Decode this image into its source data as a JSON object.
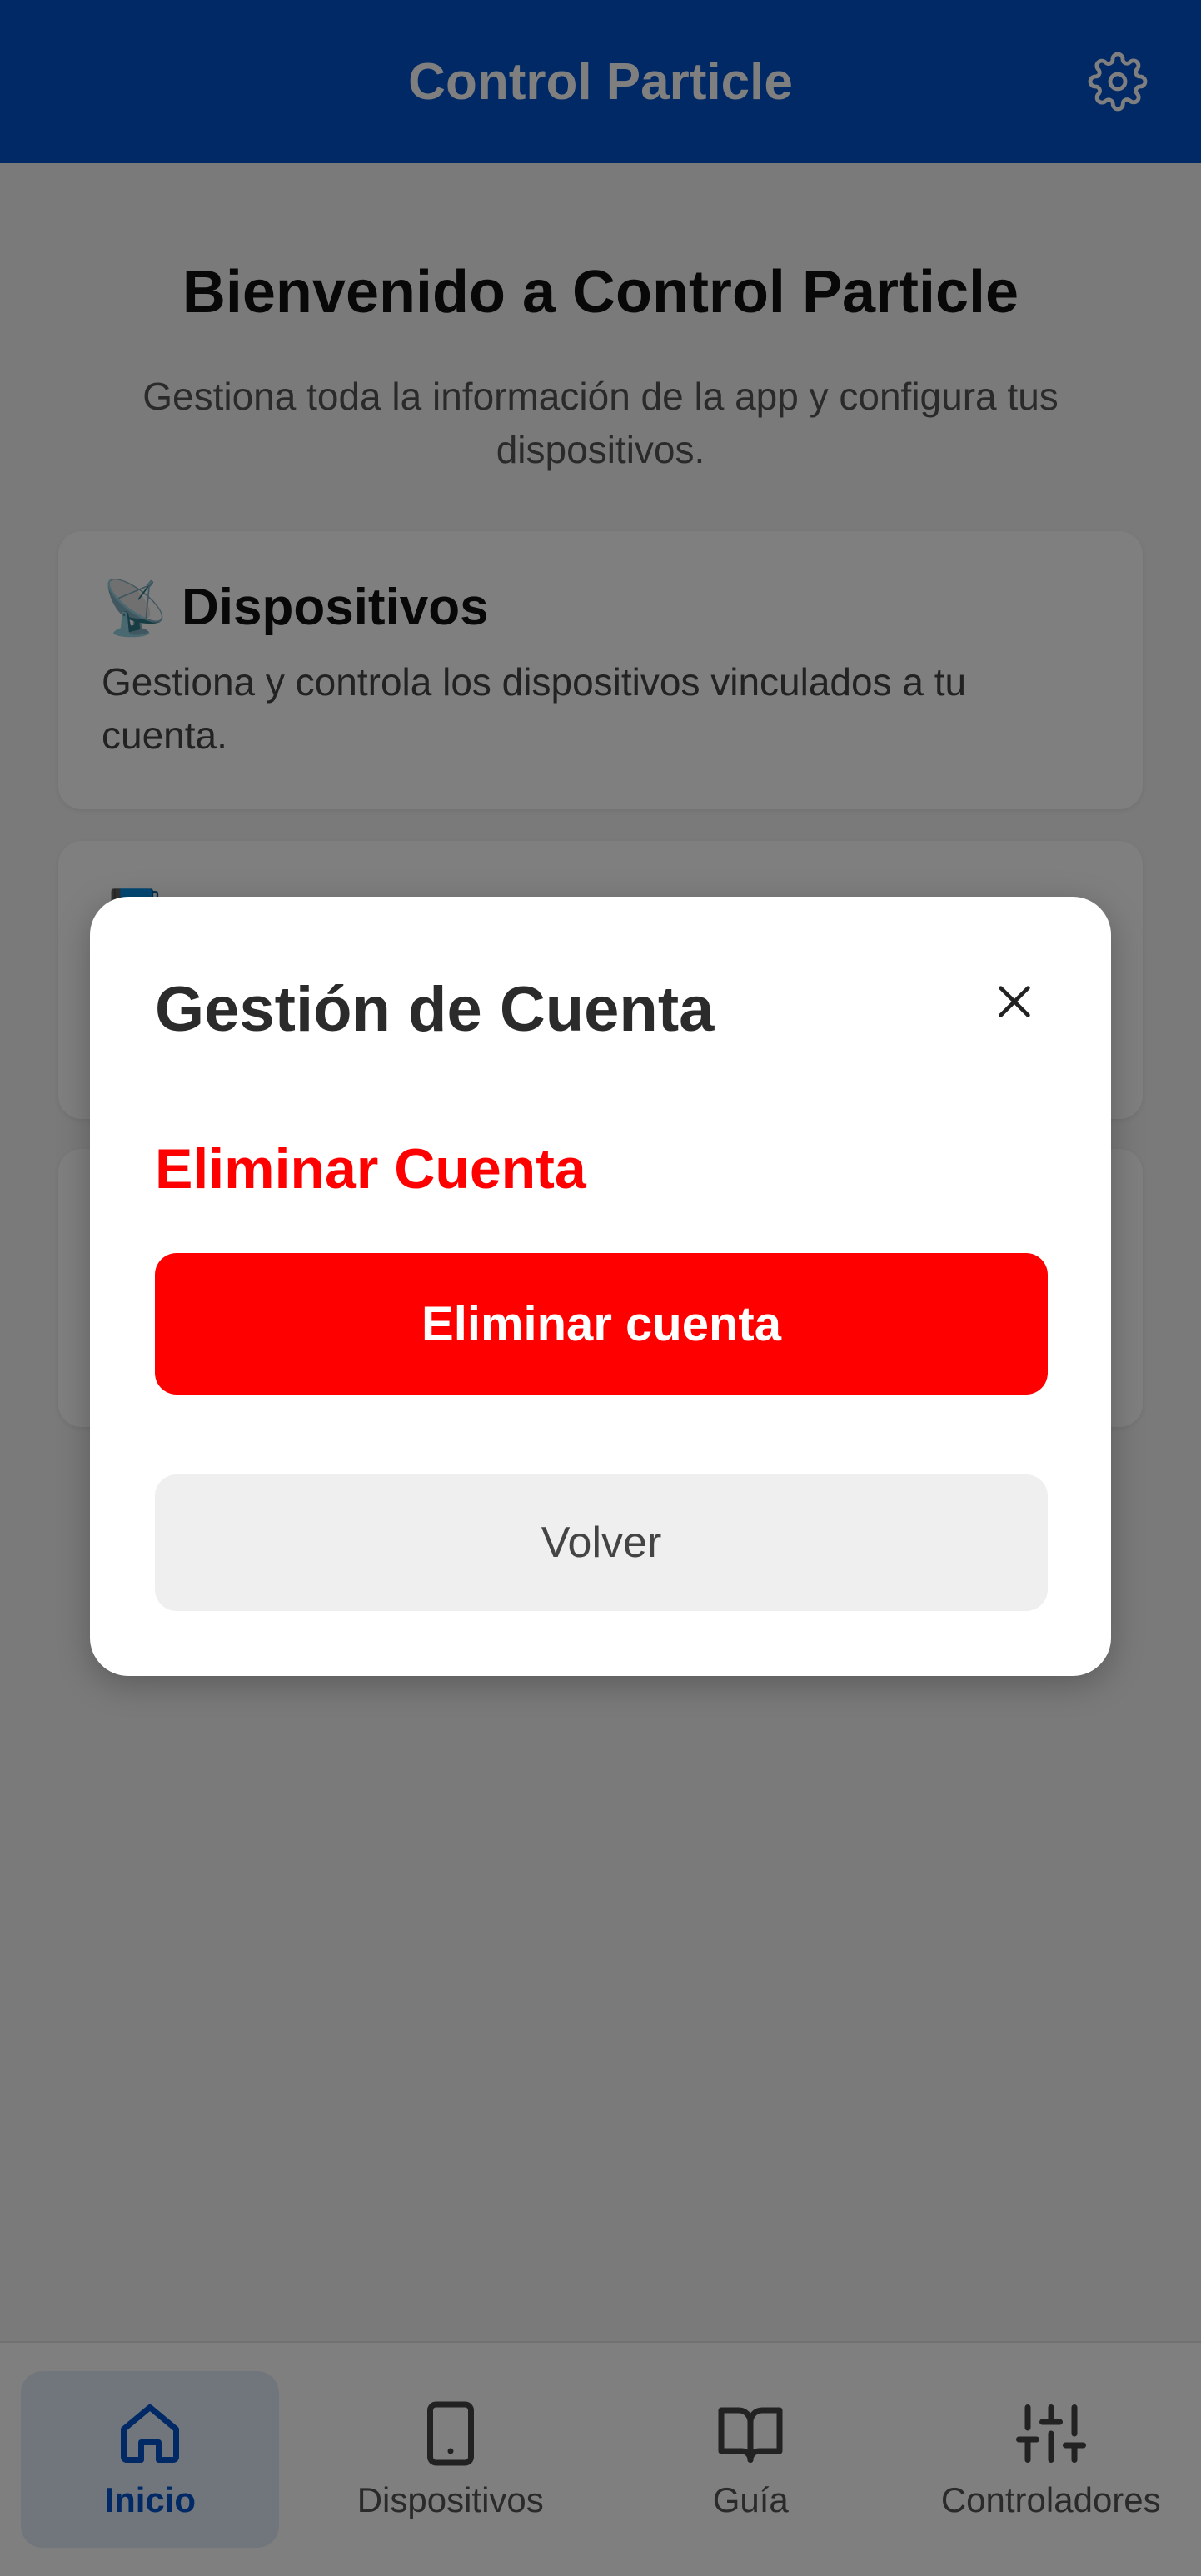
{
  "header": {
    "title": "Control Particle",
    "settings_icon": "gear-icon"
  },
  "main": {
    "title": "Bienvenido a Control Particle",
    "subtitle": "Gestiona toda la información de la app y configura tus dispositivos.",
    "cards": [
      {
        "icon": "📡",
        "title": "Dispositivos",
        "description": "Gestiona y controla los dispositivos vinculados a tu cuenta."
      },
      {
        "icon": "📘",
        "title": "",
        "description": ""
      },
      {
        "icon": "",
        "title": "",
        "description": ""
      }
    ]
  },
  "modal": {
    "title": "Gestión de Cuenta",
    "section_title": "Eliminar Cuenta",
    "delete_button": "Eliminar cuenta",
    "back_button": "Volver"
  },
  "nav": {
    "items": [
      {
        "label": "Inicio",
        "icon": "home-icon",
        "active": true
      },
      {
        "label": "Dispositivos",
        "icon": "tablet-icon",
        "active": false
      },
      {
        "label": "Guía",
        "icon": "book-icon",
        "active": false
      },
      {
        "label": "Controladores",
        "icon": "sliders-icon",
        "active": false
      }
    ]
  },
  "colors": {
    "primary": "#0052cc",
    "danger": "#ff0000",
    "overlay": "rgba(0,0,0,0.5)"
  }
}
